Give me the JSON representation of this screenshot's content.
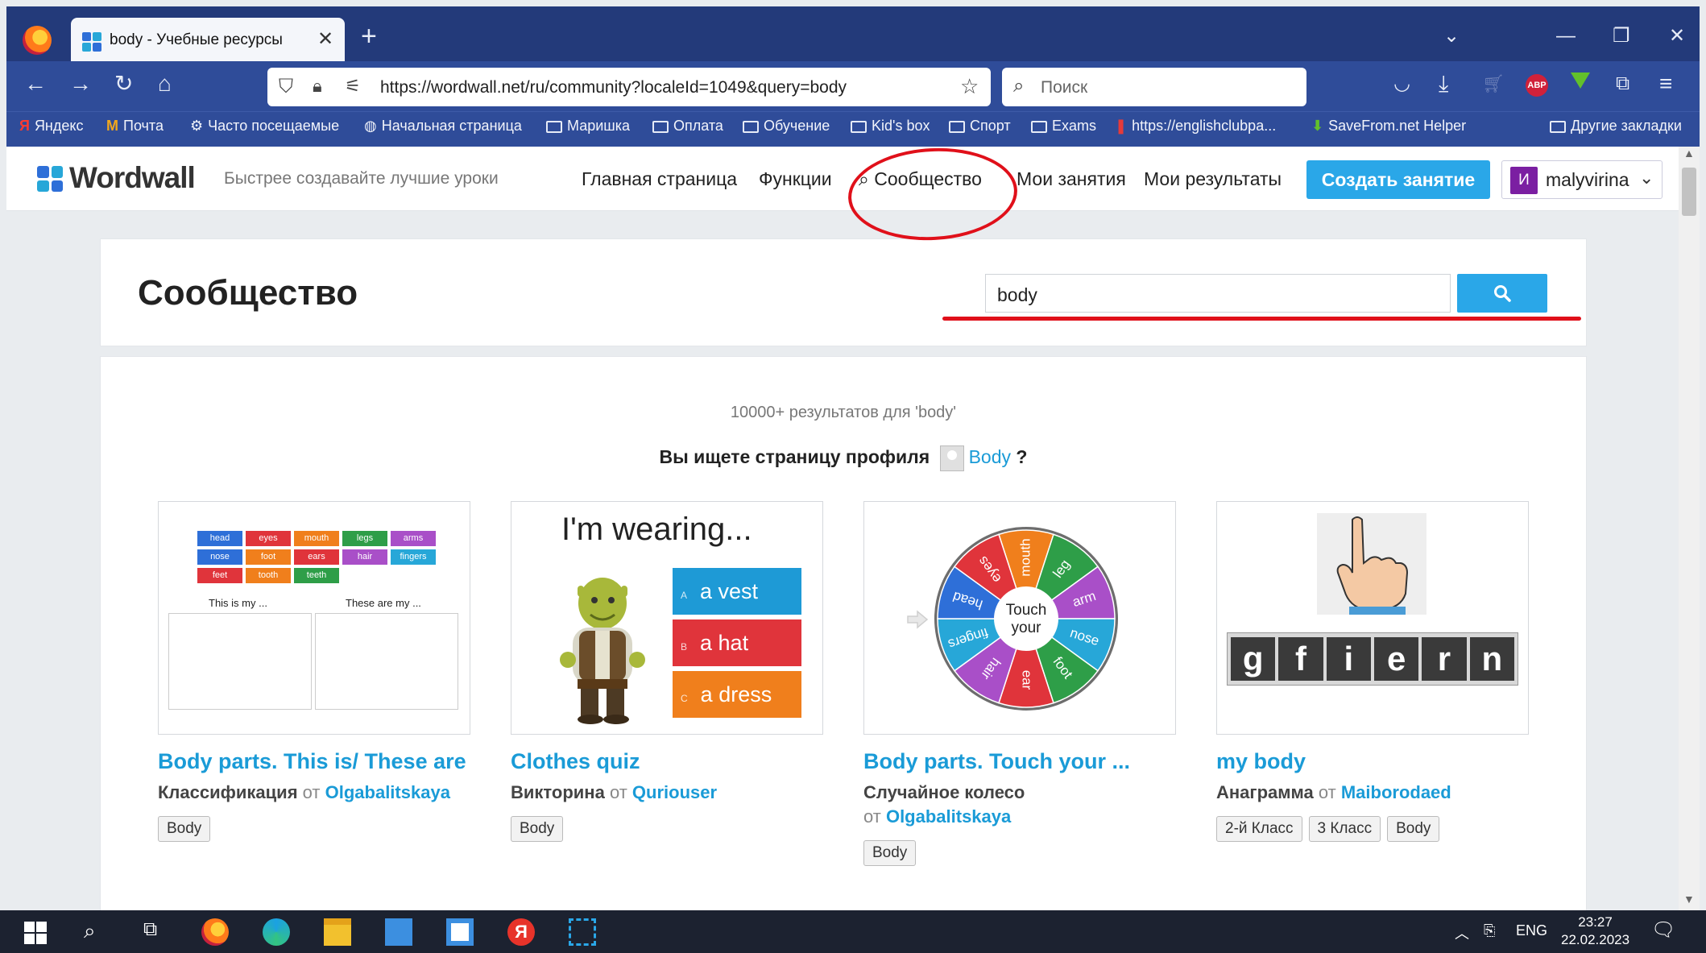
{
  "browser": {
    "tab_title": "body - Учебные ресурсы",
    "url": "https://wordwall.net/ru/community?localeId=1049&query=body",
    "search_placeholder": "Поиск",
    "bookmarks": [
      "Яндекс",
      "Почта",
      "Часто посещаемые",
      "Начальная страница",
      "Маришка",
      "Оплата",
      "Обучение",
      "Kid's box",
      "Спорт",
      "Exams",
      "https://englishclubpa...",
      "SaveFrom.net Helper",
      "Другие закладки"
    ]
  },
  "site": {
    "logo": "Wordwall",
    "slogan": "Быстрее создавайте лучшие уроки",
    "nav": [
      "Главная страница",
      "Функции",
      "Сообщество",
      "Мои занятия",
      "Мои результаты"
    ],
    "create_button": "Создать занятие",
    "user": {
      "initial": "И",
      "name": "malyvirina"
    }
  },
  "community": {
    "title": "Сообщество",
    "query": "body",
    "result_count": "10000+ результатов для 'body'",
    "profile_prompt": "Вы ищете страницу профиля",
    "profile_link": "Body",
    "profile_suffix": "?"
  },
  "cards": [
    {
      "title": "Body parts. This is/ These are",
      "type": "Классификация",
      "from": "от",
      "author": "Olgabalitskaya",
      "tags": [
        "Body"
      ],
      "thumb": {
        "words": [
          "head",
          "eyes",
          "mouth",
          "legs",
          "arms",
          "nose",
          "foot",
          "ears",
          "hair",
          "fingers",
          "feet",
          "tooth",
          "teeth"
        ],
        "word_colors": [
          "#2e6fd8",
          "#e0343b",
          "#f07f1c",
          "#2e9e48",
          "#a94fc8",
          "#2e6fd8",
          "#f07f1c",
          "#e0343b",
          "#a94fc8",
          "#27a7d8",
          "#e0343b",
          "#f07f1c",
          "#2e9e48"
        ],
        "left_label": "This is my ...",
        "right_label": "These are my ..."
      }
    },
    {
      "title": "Clothes quiz",
      "type": "Викторина",
      "from": "от",
      "author": "Quriouser",
      "tags": [
        "Body"
      ],
      "thumb": {
        "heading": "I'm wearing...",
        "answers": [
          {
            "letter": "A",
            "text": "a vest",
            "color": "#1e9ad6"
          },
          {
            "letter": "B",
            "text": "a hat",
            "color": "#e0343b"
          },
          {
            "letter": "C",
            "text": "a dress",
            "color": "#f07f1c"
          }
        ]
      }
    },
    {
      "title": "Body parts. Touch your ...",
      "type": "Случайное колесо",
      "from": "от",
      "author": "Olgabalitskaya",
      "tags": [
        "Body"
      ],
      "thumb": {
        "center": "Touch your",
        "segments": [
          "mouth",
          "leg",
          "arm",
          "nose",
          "foot",
          "ear",
          "hair",
          "fingers",
          "head",
          "eyes"
        ],
        "segment_colors": [
          "#f07f1c",
          "#2e9e48",
          "#a94fc8",
          "#27a7d8",
          "#2e9e48",
          "#e0343b",
          "#a94fc8",
          "#27a7d8",
          "#2e6fd8",
          "#e0343b"
        ]
      }
    },
    {
      "title": "my body",
      "type": "Анаграмма",
      "from": "от",
      "author": "Maiborodaed",
      "tags": [
        "2-й Класс",
        "3 Класс",
        "Body"
      ],
      "thumb": {
        "letters": [
          "g",
          "f",
          "i",
          "e",
          "r",
          "n"
        ]
      }
    }
  ],
  "taskbar": {
    "lang": "ENG",
    "time": "23:27",
    "date": "22.02.2023"
  },
  "colors": {
    "accent": "#2aa7e8",
    "link": "#1a9bd7",
    "annotation": "#e0101a"
  }
}
